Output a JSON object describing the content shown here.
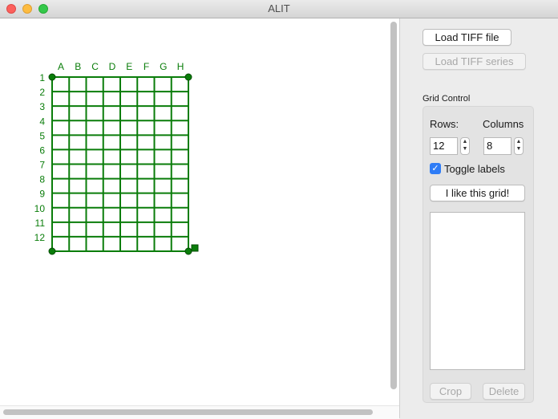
{
  "window": {
    "title": "ALIT"
  },
  "grid": {
    "columns": [
      "A",
      "B",
      "C",
      "D",
      "E",
      "F",
      "G",
      "H"
    ],
    "rows": [
      "1",
      "2",
      "3",
      "4",
      "5",
      "6",
      "7",
      "8",
      "9",
      "10",
      "11",
      "12"
    ],
    "color": "#0a7d0a"
  },
  "panel": {
    "load_tiff_file": "Load TIFF file",
    "load_tiff_series": "Load TIFF series",
    "grid_control_label": "Grid Control",
    "rows_label": "Rows:",
    "columns_label": "Columns",
    "rows_value": "12",
    "columns_value": "8",
    "toggle_labels": "Toggle labels",
    "toggle_labels_checked": true,
    "like_grid_button": "I like this grid!",
    "crop_button": "Crop",
    "delete_button": "Delete"
  }
}
